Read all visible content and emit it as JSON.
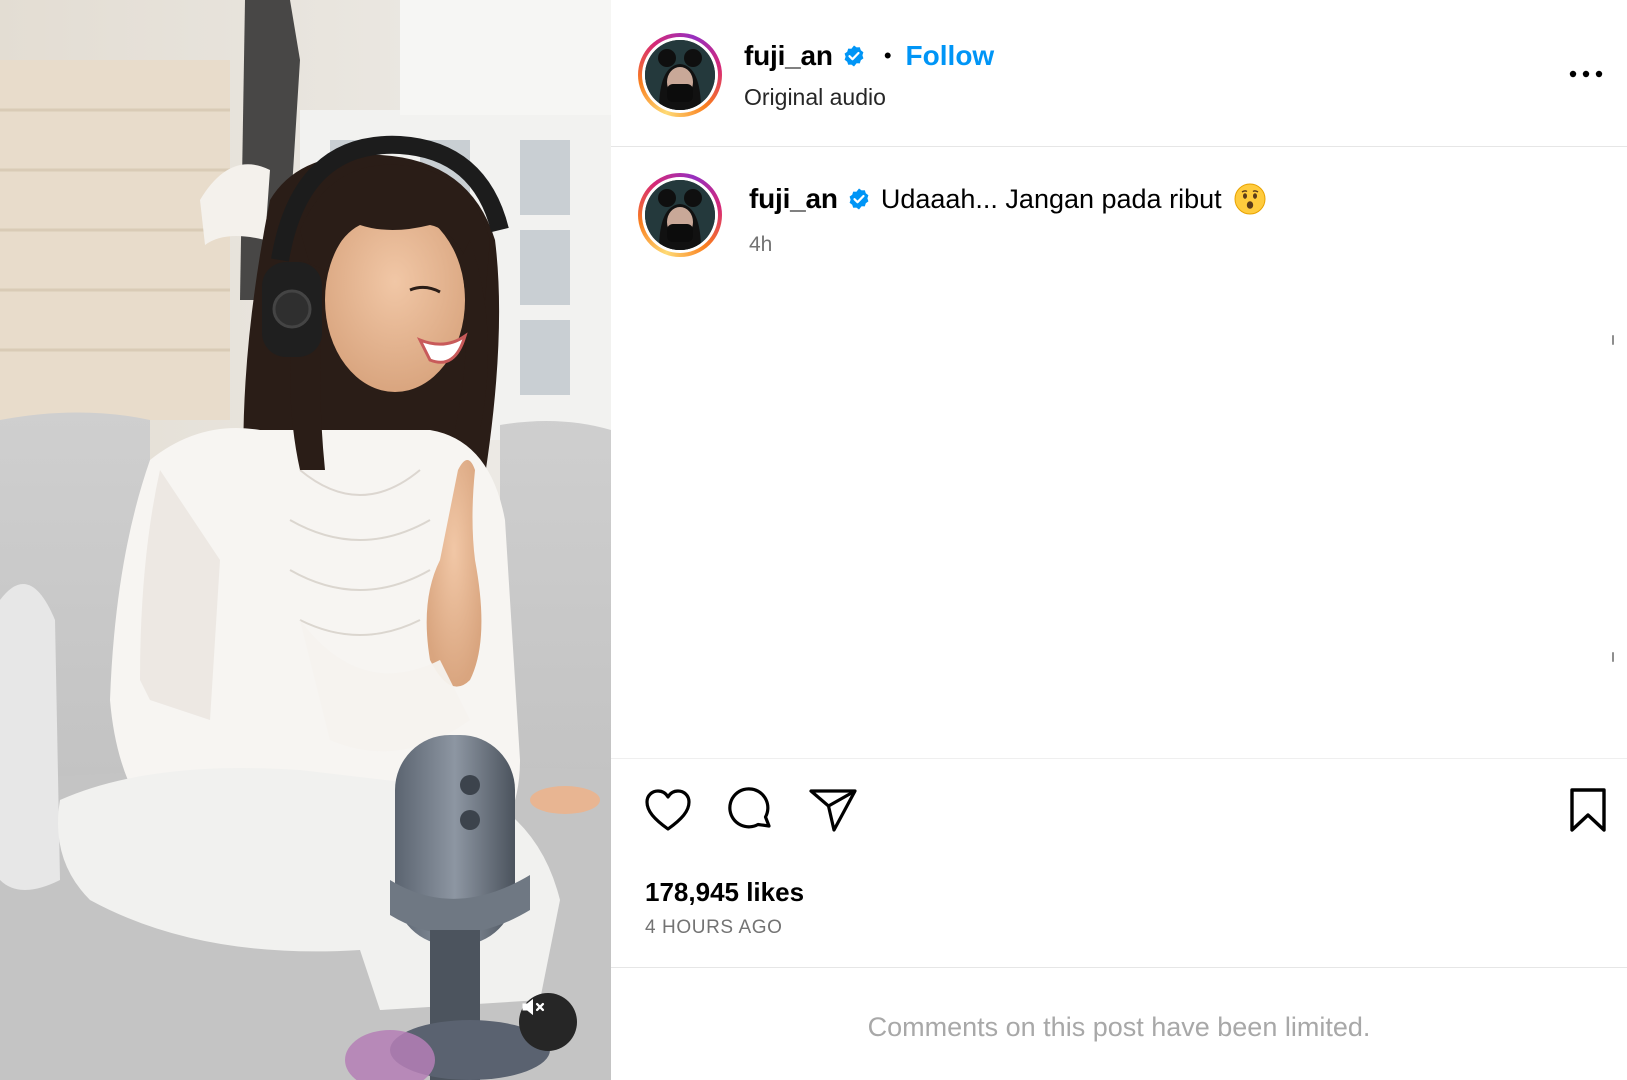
{
  "post": {
    "username": "fuji_an",
    "separator": "•",
    "follow_label": "Follow",
    "audio_label": "Original audio",
    "caption_text": "Udaaah... Jangan pada ribut",
    "caption_time": "4h",
    "likes": "178,945 likes",
    "posted_ago": "4 HOURS AGO",
    "comments_notice": "Comments on this post have been limited."
  },
  "icons": {
    "verified": "verified-badge-icon",
    "more": "more-options-icon",
    "like": "heart-icon",
    "comment": "comment-icon",
    "share": "paper-plane-icon",
    "save": "bookmark-icon",
    "mute": "speaker-muted-icon",
    "emoji": "hushed-face-emoji"
  },
  "colors": {
    "follow": "#0095f6",
    "verified": "#0095f6",
    "secondary_text": "#737373",
    "notice_text": "#a8a8a8"
  }
}
